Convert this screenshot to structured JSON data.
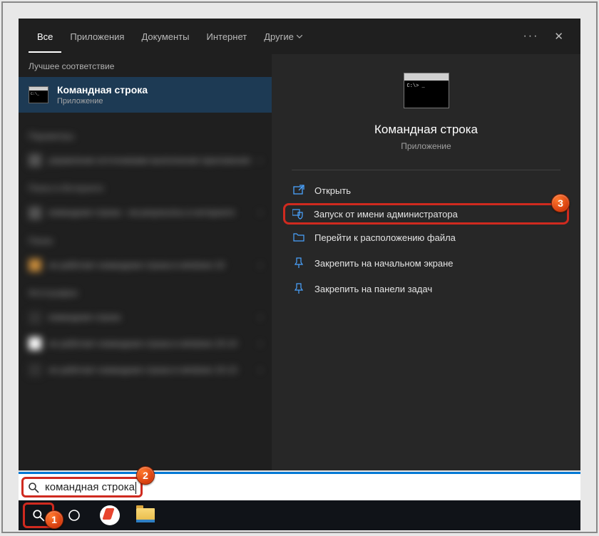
{
  "tabs": {
    "all": "Все",
    "apps": "Приложения",
    "docs": "Документы",
    "web": "Интернет",
    "more": "Другие"
  },
  "left": {
    "best_match": "Лучшее соответствие",
    "result": {
      "title": "Командная строка",
      "sub": "Приложение"
    }
  },
  "preview": {
    "title": "Командная строка",
    "sub": "Приложение"
  },
  "actions": {
    "open": "Открыть",
    "run_admin": "Запуск от имени администратора",
    "file_location": "Перейти к расположению файла",
    "pin_start": "Закрепить на начальном экране",
    "pin_taskbar": "Закрепить на панели задач"
  },
  "search": {
    "query": "командная строка"
  },
  "badges": {
    "b1": "1",
    "b2": "2",
    "b3": "3"
  }
}
